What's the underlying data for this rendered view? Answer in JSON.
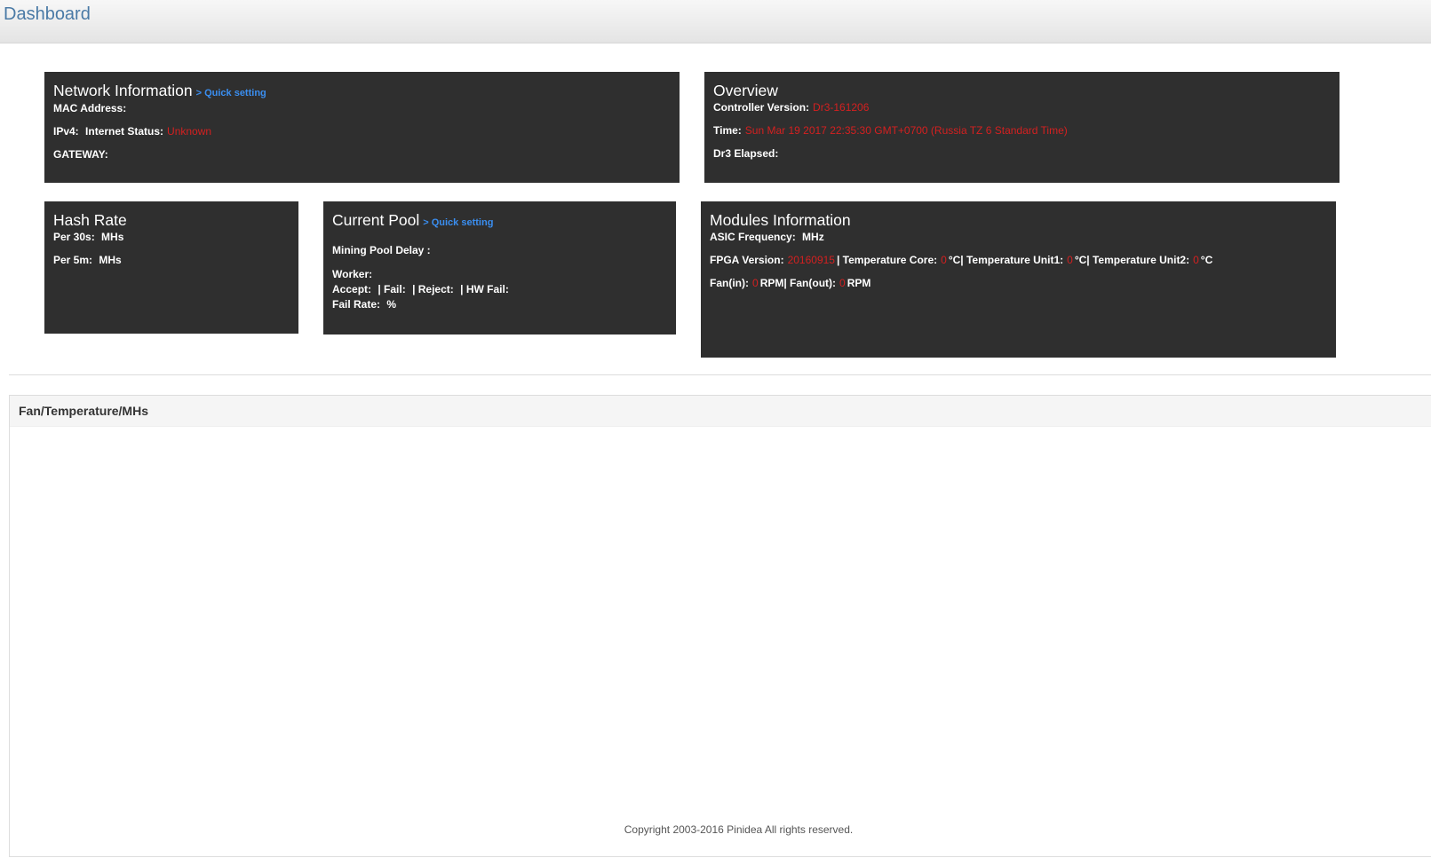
{
  "header": {
    "title": "Dashboard"
  },
  "network": {
    "title": "Network Information",
    "quick_setting": "> Quick setting",
    "mac_label": "MAC Address:",
    "mac_value": "",
    "ipv4_label": "IPv4:",
    "ipv4_value": "",
    "internet_label": "Internet Status:",
    "internet_value": "Unknown",
    "gateway_label": "GATEWAY:",
    "gateway_value": ""
  },
  "overview": {
    "title": "Overview",
    "controller_label": "Controller Version:",
    "controller_value": "Dr3-161206",
    "time_label": "Time:",
    "time_value": "Sun Mar 19 2017 22:35:30 GMT+0700 (Russia TZ 6 Standard Time)",
    "elapsed_label": "Dr3 Elapsed:",
    "elapsed_value": ""
  },
  "hashrate": {
    "title": "Hash Rate",
    "per30s_label": "Per 30s:",
    "per30s_unit": "MHs",
    "per5m_label": "Per 5m:",
    "per5m_unit": "MHs"
  },
  "pool": {
    "title": "Current Pool",
    "quick_setting": "> Quick setting",
    "delay_label": "Mining Pool Delay :",
    "worker_label": "Worker:",
    "accept_label": "Accept:",
    "fail_label": "| Fail:",
    "reject_label": "| Reject:",
    "hwfail_label": "| HW Fail:",
    "failrate_label": "Fail Rate:",
    "failrate_unit": "%"
  },
  "modules": {
    "title": "Modules Information",
    "asic_label": "ASIC Frequency:",
    "asic_unit": "MHz",
    "fpga_label": "FPGA Version:",
    "fpga_value": "20160915",
    "tcore_label": "| Temperature Core:",
    "tcore_value": "0",
    "tcore_unit": "°C",
    "tunit1_label": "| Temperature Unit1:",
    "tunit1_value": "0",
    "tunit1_unit": "°C",
    "tunit2_label": "| Temperature Unit2:",
    "tunit2_value": "0",
    "tunit2_unit": "°C",
    "fanin_label": "Fan(in):",
    "fanin_value": "0",
    "fanin_unit": "RPM",
    "fanout_label": "| Fan(out):",
    "fanout_value": "0",
    "fanout_unit": "RPM"
  },
  "chart_panel": {
    "title": "Fan/Temperature/MHs"
  },
  "footer": {
    "copyright": "Copyright 2003-2016 Pinidea All rights reserved."
  }
}
